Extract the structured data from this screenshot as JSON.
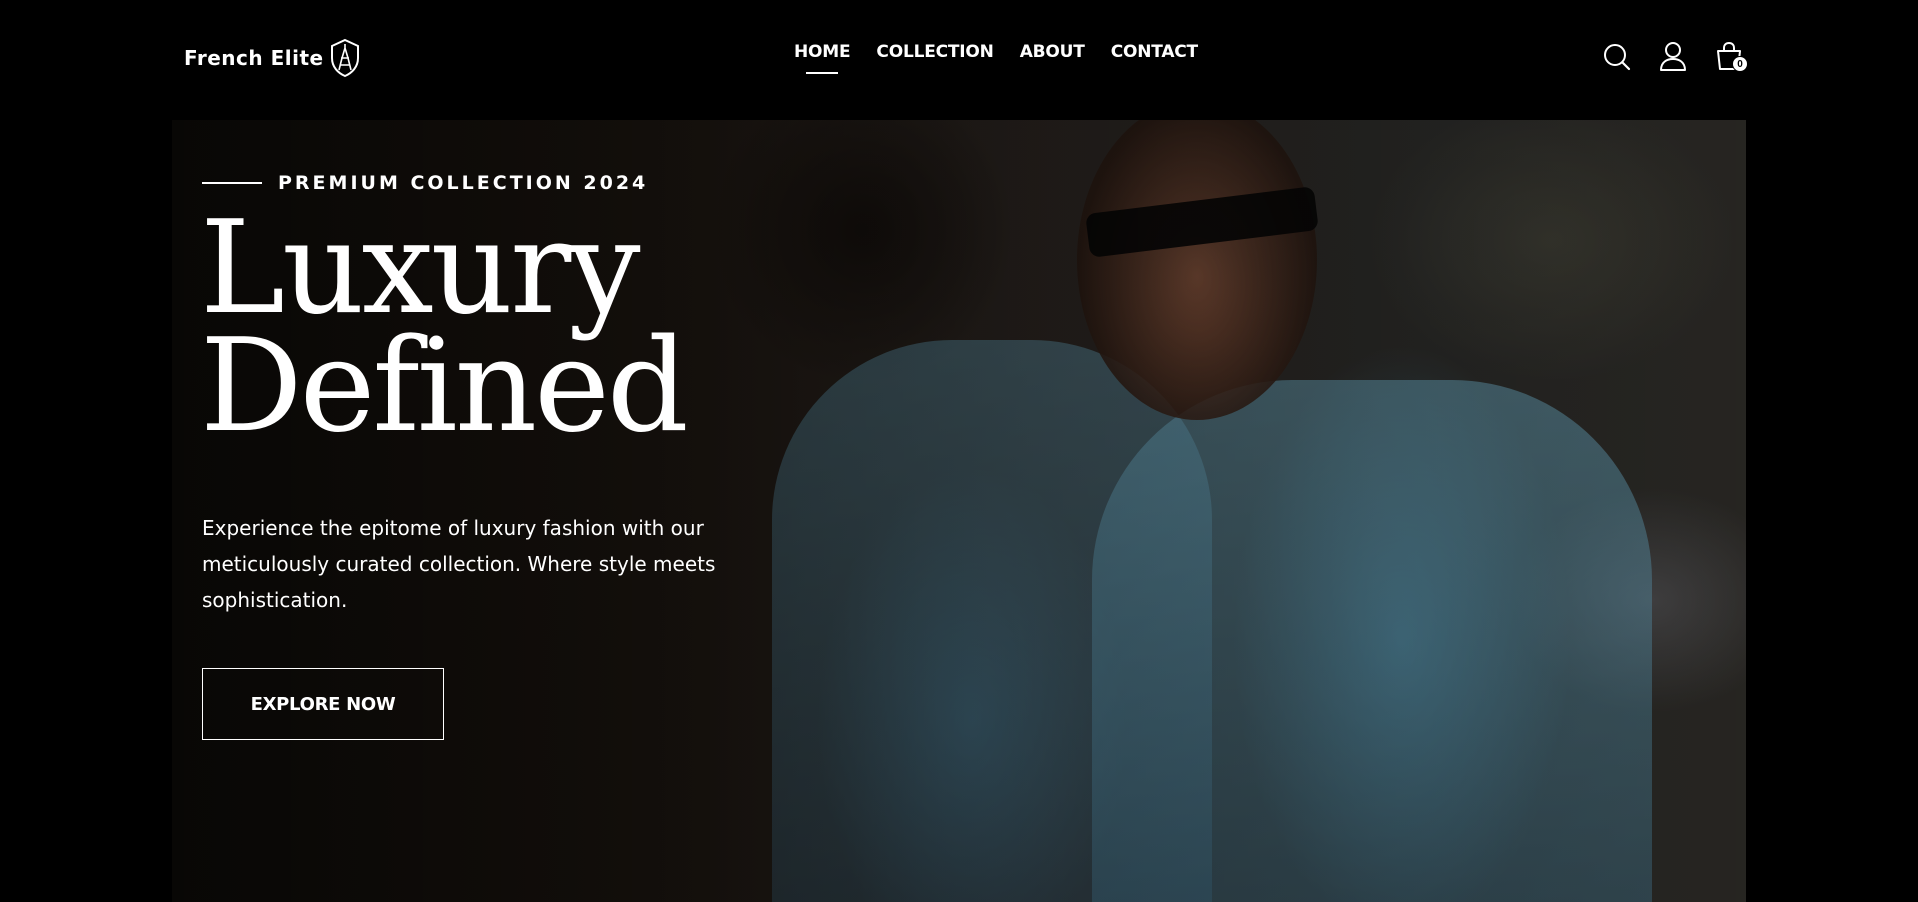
{
  "brand": {
    "name": "French Elite",
    "logo_icon": "eiffel-tower-shield-icon"
  },
  "nav": {
    "items": [
      {
        "label": "HOME",
        "active": true
      },
      {
        "label": "COLLECTION",
        "active": false
      },
      {
        "label": "ABOUT",
        "active": false
      },
      {
        "label": "CONTACT",
        "active": false
      }
    ]
  },
  "header_icons": {
    "search": "search-icon",
    "account": "user-icon",
    "cart": "shopping-bag-icon",
    "cart_count": "0"
  },
  "hero": {
    "eyebrow": "PREMIUM COLLECTION 2024",
    "headline_line1": "Luxury",
    "headline_line2": "Defined",
    "description": "Experience the epitome of luxury fashion with our meticulously curated collection. Where style meets sophistication.",
    "cta_label": "EXPLORE NOW"
  },
  "colors": {
    "background": "#000000",
    "text": "#ffffff"
  }
}
